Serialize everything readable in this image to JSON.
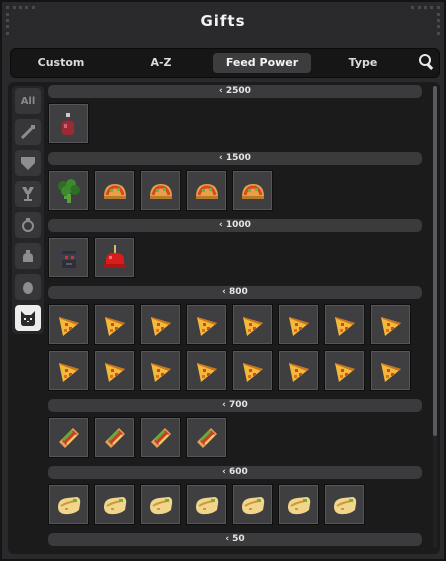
{
  "window": {
    "title": "Gifts"
  },
  "tabs": [
    {
      "label": "Custom",
      "active": false
    },
    {
      "label": "A-Z",
      "active": false
    },
    {
      "label": "Feed Power",
      "active": true
    },
    {
      "label": "Type",
      "active": false
    }
  ],
  "search_icon": "magnifier-icon",
  "categories": [
    {
      "label": "All",
      "icon": "all-label"
    },
    {
      "icon": "wand-icon"
    },
    {
      "icon": "shield-icon"
    },
    {
      "icon": "goblet-icon"
    },
    {
      "icon": "ring-icon"
    },
    {
      "icon": "pouch-icon"
    },
    {
      "icon": "egg-icon"
    },
    {
      "icon": "cat-face-icon",
      "active": true
    }
  ],
  "groups": [
    {
      "label": "‹ 2500",
      "items": [
        "potion"
      ]
    },
    {
      "label": "‹ 1500",
      "items": [
        "broccoli",
        "taco",
        "taco",
        "taco",
        "taco"
      ]
    },
    {
      "label": "‹ 1000",
      "items": [
        "armor",
        "candy-apple"
      ]
    },
    {
      "label": "‹ 800",
      "items": [
        "pizza",
        "pizza",
        "pizza",
        "pizza",
        "pizza",
        "pizza",
        "pizza",
        "pizza",
        "pizza",
        "pizza",
        "pizza",
        "pizza",
        "pizza",
        "pizza",
        "pizza",
        "pizza"
      ]
    },
    {
      "label": "‹ 700",
      "items": [
        "sandwich",
        "sandwich",
        "sandwich",
        "sandwich"
      ]
    },
    {
      "label": "‹ 600",
      "items": [
        "burrito",
        "burrito",
        "burrito",
        "burrito",
        "burrito",
        "burrito",
        "burrito"
      ]
    },
    {
      "label": "‹ 50",
      "items": []
    }
  ],
  "colors": {
    "panel": "#2a2a2c",
    "slot": "#3f3f42",
    "header": "#3b3b3e",
    "active_tab": "#3d3d40"
  },
  "scroll": {
    "position": 0.0,
    "visible_fraction": 0.76
  }
}
